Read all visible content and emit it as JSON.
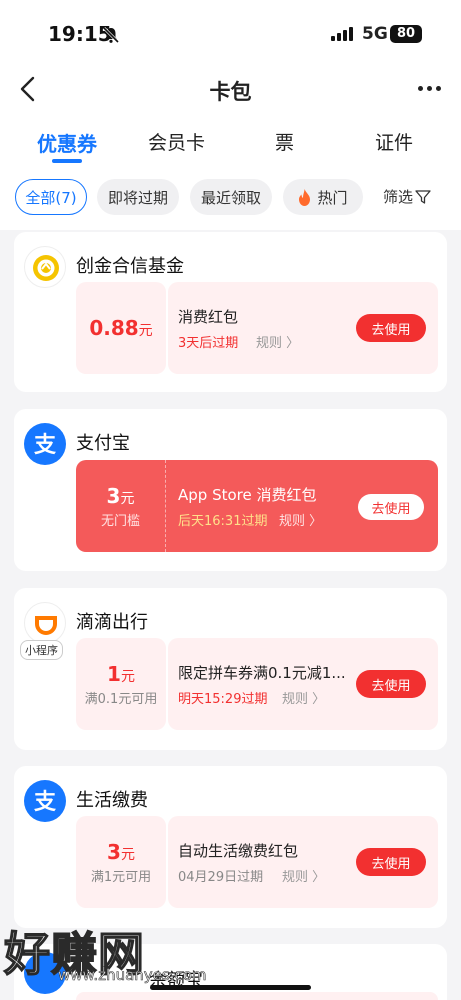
{
  "status": {
    "time": "19:15",
    "network": "5G",
    "battery": "80"
  },
  "nav": {
    "title": "卡包"
  },
  "tabs": [
    {
      "label": "优惠券"
    },
    {
      "label": "会员卡"
    },
    {
      "label": "票"
    },
    {
      "label": "证件"
    }
  ],
  "filters": [
    {
      "label": "全部(7)"
    },
    {
      "label": "即将过期"
    },
    {
      "label": "最近领取"
    },
    {
      "label": "热门"
    }
  ],
  "filter_btn": "筛选",
  "cards": [
    {
      "merchant": "创金合信基金",
      "amount": "0.88",
      "unit": "元",
      "condition": "",
      "name": "消费红包",
      "expiry": "3天后过期",
      "rule": "规则 〉",
      "button": "去使用"
    },
    {
      "merchant": "支付宝",
      "amount": "3",
      "unit": "元",
      "condition": "无门槛",
      "name": "App Store 消费红包",
      "expiry": "后天16:31过期",
      "rule": "规则 〉",
      "button": "去使用"
    },
    {
      "merchant": "滴滴出行",
      "tag": "小程序",
      "amount": "1",
      "unit": "元",
      "condition": "满0.1元可用",
      "name": "限定拼车券满0.1元减1...",
      "expiry": "明天15:29过期",
      "rule": "规则 〉",
      "button": "去使用"
    },
    {
      "merchant": "生活缴费",
      "amount": "3",
      "unit": "元",
      "condition": "满1元可用",
      "name": "自动生活缴费红包",
      "expiry": "04月29日过期",
      "rule": "规则 〉",
      "button": "去使用"
    },
    {
      "merchant": "余额宝"
    }
  ],
  "watermark": {
    "text": "好赚网",
    "url": "www.zhuanyes.com"
  },
  "colors": {
    "accent": "#1677ff",
    "red": "#f23030",
    "highlight": "#f45a5a"
  }
}
